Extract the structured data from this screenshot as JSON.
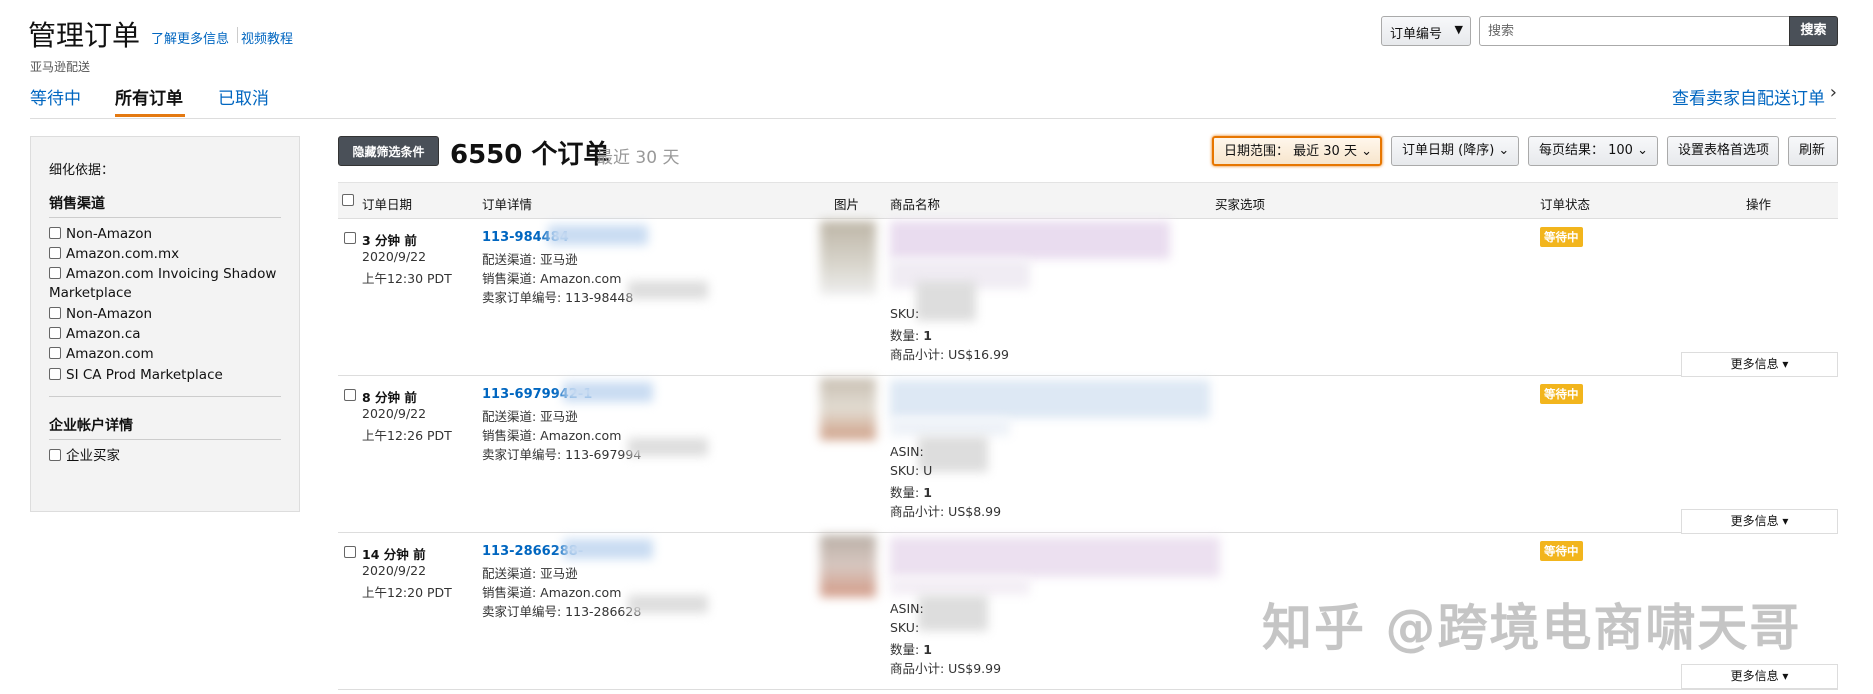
{
  "header": {
    "title": "管理订单",
    "learn_more": "了解更多信息",
    "video_tutorial": "视频教程",
    "subtitle": "亚马逊配送",
    "view_seller_orders": "查看卖家自配送订单"
  },
  "tabs": [
    {
      "label": "等待中",
      "active": false
    },
    {
      "label": "所有订单",
      "active": true
    },
    {
      "label": "已取消",
      "active": false
    }
  ],
  "search": {
    "type_label": "订单编号",
    "placeholder": "搜索",
    "button": "搜索"
  },
  "sidebar": {
    "refine_label": "细化依据：",
    "channel_head": "销售渠道",
    "channels": [
      "Non-Amazon",
      "Amazon.com.mx",
      "Amazon.com Invoicing Shadow Marketplace",
      "Non-Amazon",
      "Amazon.ca",
      "Amazon.com",
      "SI CA Prod Marketplace"
    ],
    "business_head": "企业帐户详情",
    "business_items": [
      "企业买家"
    ]
  },
  "toolbar": {
    "hide_filters": "隐藏筛选条件",
    "count": "6550 个订单",
    "recent": "最近 30 天",
    "date_range": "日期范围： 最近 30 天",
    "sort": "订单日期 (降序)",
    "per_page": "每页结果： 100",
    "set_pref": "设置表格首选项",
    "refresh": "刷新"
  },
  "table": {
    "headers": [
      "订单日期",
      "订单详情",
      "图片",
      "商品名称",
      "买家选项",
      "订单状态",
      "操作"
    ],
    "rows": [
      {
        "ago": "3 分钟 前",
        "date": "2020/9/22",
        "time": "上午12:30 PDT",
        "order_id": "113-984484",
        "ship": "配送渠道: 亚马逊",
        "sales": "销售渠道: Amazon.com",
        "seller_id": "卖家订单编号: 113-98448",
        "asin": "",
        "sku": "SKU:",
        "qty_label": "数量:",
        "qty": "1",
        "subtotal": "商品小计: US$16.99",
        "status": "等待中",
        "more": "更多信息"
      },
      {
        "ago": "8 分钟 前",
        "date": "2020/9/22",
        "time": "上午12:26 PDT",
        "order_id": "113-6979942-1",
        "ship": "配送渠道: 亚马逊",
        "sales": "销售渠道: Amazon.com",
        "seller_id": "卖家订单编号: 113-697994",
        "asin": "ASIN:",
        "sku": "SKU: U",
        "qty_label": "数量:",
        "qty": "1",
        "subtotal": "商品小计: US$8.99",
        "status": "等待中",
        "more": "更多信息"
      },
      {
        "ago": "14 分钟 前",
        "date": "2020/9/22",
        "time": "上午12:20 PDT",
        "order_id": "113-2866288-",
        "ship": "配送渠道: 亚马逊",
        "sales": "销售渠道: Amazon.com",
        "seller_id": "卖家订单编号: 113-286628",
        "asin": "ASIN:",
        "sku": "SKU:",
        "qty_label": "数量:",
        "qty": "1",
        "subtotal": "商品小计: US$9.99",
        "status": "等待中",
        "more": "更多信息"
      }
    ]
  },
  "watermark": "知乎 @跨境电商啸天哥",
  "colors": {
    "link": "#0066c0",
    "badge": "#f2b51d",
    "tab_underline": "#e47911",
    "dark_button": "#4a5058"
  }
}
